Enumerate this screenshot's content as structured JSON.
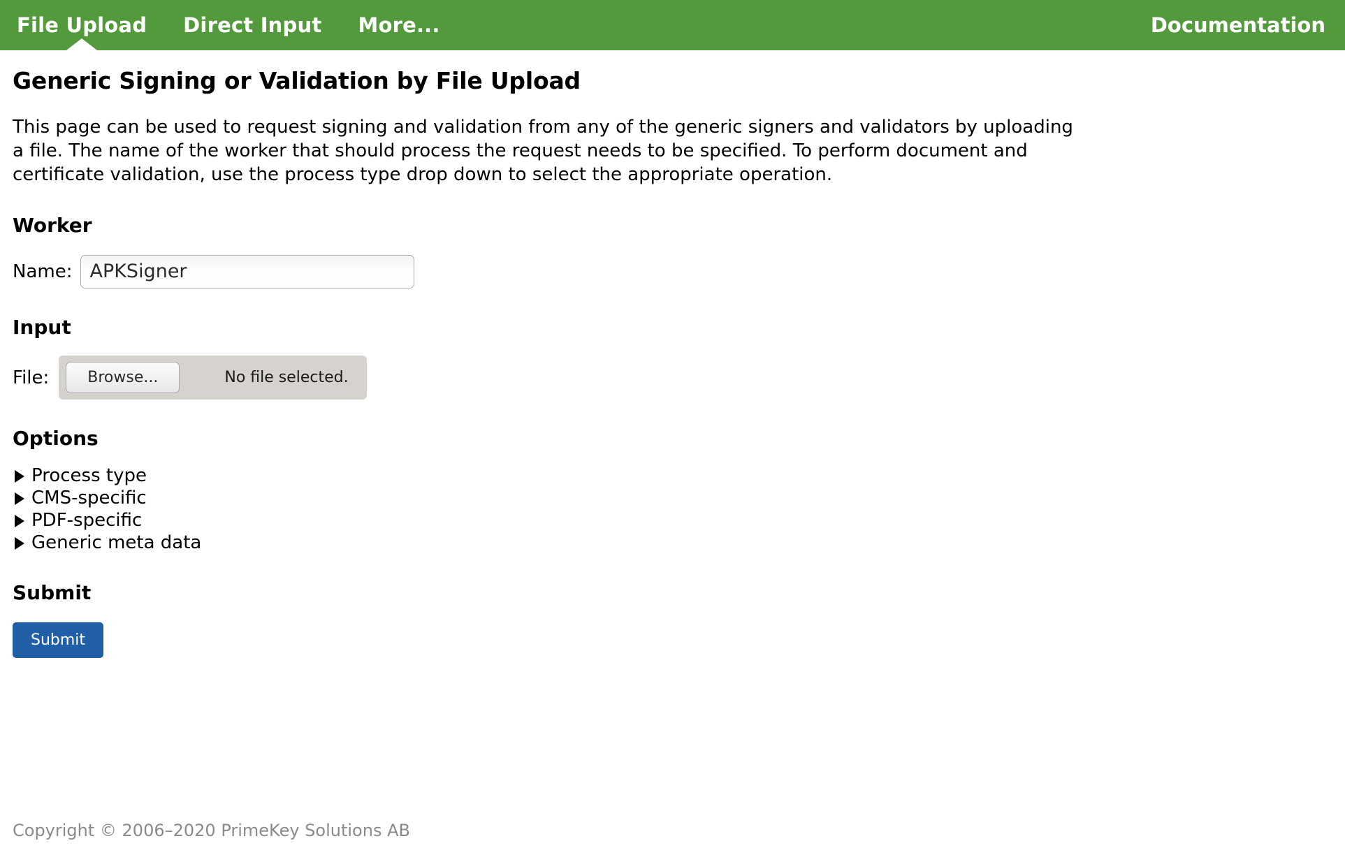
{
  "nav": {
    "items": [
      {
        "label": "File Upload",
        "active": true
      },
      {
        "label": "Direct Input",
        "active": false
      },
      {
        "label": "More...",
        "active": false
      }
    ],
    "right_link": "Documentation",
    "background_color": "#539A3C",
    "text_color": "#FFFFFF"
  },
  "page": {
    "title": "Generic Signing or Validation by File Upload",
    "description": "This page can be used to request signing and validation from any of the generic signers and validators by uploading a file. The name of the worker that should process the request needs to be specified. To perform document and certificate validation, use the process type drop down to select the appropriate operation."
  },
  "worker": {
    "heading": "Worker",
    "name_label": "Name:",
    "name_value": "APKSigner",
    "name_placeholder": ""
  },
  "input": {
    "heading": "Input",
    "file_label": "File:",
    "browse_label": "Browse...",
    "file_status": "No file selected."
  },
  "options": {
    "heading": "Options",
    "items": [
      {
        "label": "Process type",
        "expanded": false
      },
      {
        "label": "CMS-specific",
        "expanded": false
      },
      {
        "label": "PDF-specific",
        "expanded": false
      },
      {
        "label": "Generic meta data",
        "expanded": false
      }
    ]
  },
  "submit": {
    "heading": "Submit",
    "button_label": "Submit",
    "button_color": "#205FA6"
  },
  "footer": {
    "copyright": "Copyright © 2006–2020 PrimeKey Solutions AB"
  }
}
